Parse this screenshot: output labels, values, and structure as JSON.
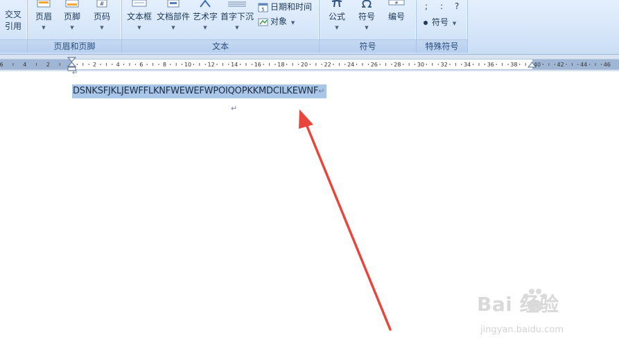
{
  "ribbon": {
    "colors": {
      "accent": "#2a4c7c",
      "selection": "#a9c5e7",
      "arrow": "#e8453c"
    },
    "partial_group": {
      "line1": "交叉",
      "line2": "引用"
    },
    "header_footer_group": {
      "label": "页眉和页脚",
      "header_label": "页眉",
      "footer_label": "页脚",
      "page_number_label": "页码"
    },
    "text_group": {
      "label": "文本",
      "textbox_label": "文本框",
      "quickparts_label": "文档部件",
      "wordart_label": "艺术字",
      "dropcap_label": "首字下沉",
      "datetime_label": "日期和时间",
      "object_label": "对象"
    },
    "symbols_group": {
      "label": "符号",
      "equation_label": "公式",
      "symbol_label": "符号",
      "numbering_label": "编号"
    },
    "special_group": {
      "label": "特殊符号",
      "chars": [
        ";",
        ":",
        "?"
      ],
      "symbol_label": "符号"
    }
  },
  "ruler": {
    "left_numbers": [
      "6",
      "4",
      "2"
    ],
    "numbers": [
      "2",
      "4",
      "6",
      "8",
      "10",
      "12",
      "14",
      "16",
      "18",
      "20",
      "22",
      "24",
      "26",
      "28",
      "30",
      "32",
      "34",
      "36",
      "38",
      "40",
      "42",
      "44",
      "46"
    ]
  },
  "document": {
    "selected_text": "DSNKSFJKLJEWFFLKNFWEWEFWPOIQOPKKMDCILKEWNF",
    "paragraph_mark": "↵"
  },
  "watermark": {
    "logo": "Bai 经验",
    "url": "jingyan.baidu.com"
  }
}
